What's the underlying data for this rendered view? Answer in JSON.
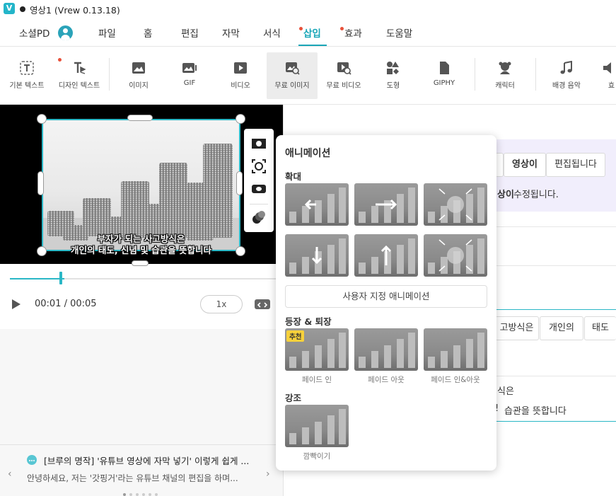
{
  "window": {
    "title": "영상1 (Vrew 0.13.18)",
    "logo_letter": "V"
  },
  "menu": {
    "account_label": "소셜PD",
    "items": [
      "파일",
      "홈",
      "편집",
      "자막",
      "서식",
      "삽입",
      "효과",
      "도움말"
    ],
    "active": "삽입"
  },
  "toolbar": {
    "tools": [
      {
        "label": "기본 텍스트",
        "icon": "text-icon"
      },
      {
        "label": "디자인 텍스트",
        "icon": "design-text-icon"
      },
      {
        "label": "이미지",
        "icon": "image-icon"
      },
      {
        "label": "GIF",
        "icon": "gif-icon"
      },
      {
        "label": "비디오",
        "icon": "video-icon"
      },
      {
        "label": "무료 이미지",
        "icon": "free-image-icon"
      },
      {
        "label": "무료 비디오",
        "icon": "free-video-icon"
      },
      {
        "label": "도형",
        "icon": "shape-icon"
      },
      {
        "label": "GIPHY",
        "icon": "giphy-icon"
      },
      {
        "label": "캐릭터",
        "icon": "character-icon"
      },
      {
        "label": "배경 음악",
        "icon": "music-icon"
      },
      {
        "label": "효",
        "icon": "sound-effect-icon"
      }
    ]
  },
  "preview": {
    "subtitle_line1": "부자가 되는 사고방식은",
    "subtitle_line2": "개인의 태도, 신념 및 습관을 뜻합니다"
  },
  "playback": {
    "time": "00:01 / 00:05",
    "speed": "1x",
    "progress": 0.2
  },
  "tips": {
    "title": "[브루의 명작] '유튜브 영상에 자막 넣기' 이렇게 쉽게 ...",
    "body": "안녕하세요, 저는 '갓핑거'라는 유튜브 채널의 편집을 하며..."
  },
  "editor": {
    "chips_top": [
      "영상이",
      "편집됩니다"
    ],
    "purple_text_bold": "상이",
    "purple_text": "수정됩니다.",
    "chips_mid": [
      "고방식은",
      "개인의",
      "태도"
    ],
    "line_a": "식은",
    "line_b_mark": "!",
    "line_b": "습관을 뜻합니다"
  },
  "animation_popup": {
    "title": "애니메이션",
    "section_zoom": "확대",
    "custom_button": "사용자 지정 애니메이션",
    "section_enter_exit": "등장 & 퇴장",
    "recommend_badge": "추천",
    "enter_exit_items": [
      "페이드 인",
      "페이드 아웃",
      "페이드 인&아웃"
    ],
    "section_emphasis": "강조",
    "emphasis_items": [
      "깜빡이기"
    ]
  }
}
